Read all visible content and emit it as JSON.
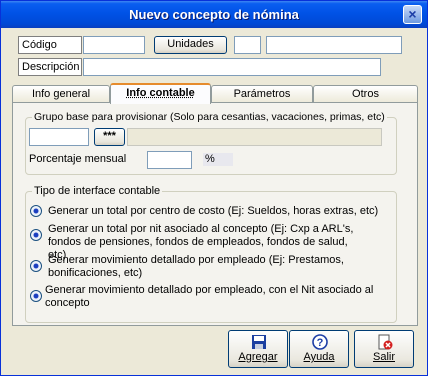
{
  "window": {
    "title": "Nuevo concepto de nómina"
  },
  "form": {
    "codigo_label": "Código",
    "unidades_label": "Unidades",
    "descripcion_label": "Descripción"
  },
  "tabs": [
    {
      "label": "Info general"
    },
    {
      "label": "Info contable"
    },
    {
      "label": "Parámetros"
    },
    {
      "label": "Otros"
    }
  ],
  "grupo_base": {
    "legend": "Grupo base para provisionar (Solo para cesantias, vacaciones, primas, etc)",
    "button_label": "***",
    "porcentaje_label": "Porcentaje mensual",
    "percent_sign": "%"
  },
  "interface": {
    "legend": "Tipo de interface contable",
    "options": [
      {
        "label": "Generar un total por centro de costo (Ej: Sueldos, horas extras, etc)"
      },
      {
        "label": "Generar un total por nit asociado al concepto (Ej: Cxp a ARL's, fondos de pensiones, fondos de empleados, fondos de salud, etc)"
      },
      {
        "label": "Generar movimiento detallado por empleado (Ej: Prestamos, bonificaciones, etc)"
      },
      {
        "label": "Generar movimiento detallado por empleado, con el Nit asociado al concepto"
      }
    ]
  },
  "buttons": {
    "agregar": "Agregar",
    "ayuda": "Ayuda",
    "salir": "Salir"
  },
  "colors": {
    "titlebar": "#0052e6",
    "accent_tab": "#e68b2c"
  }
}
